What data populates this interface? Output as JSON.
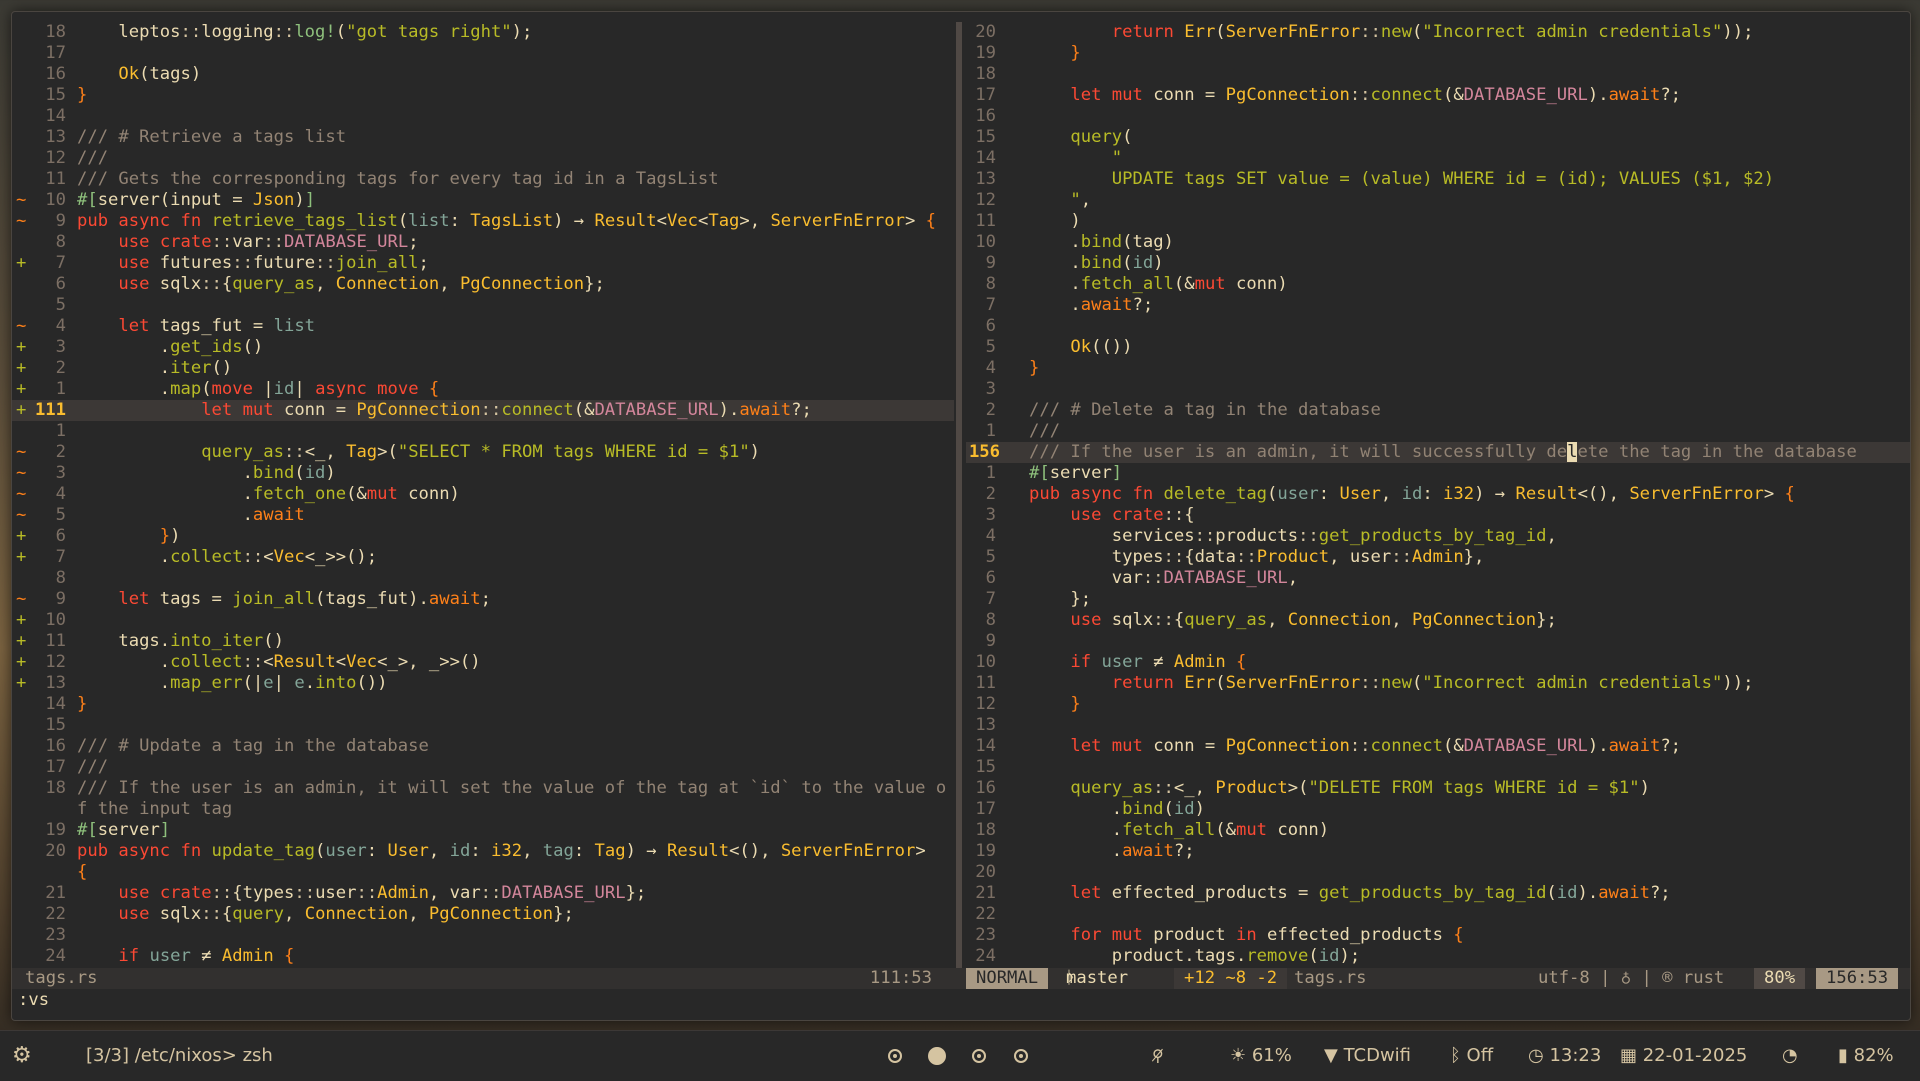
{
  "left_pane": {
    "filename": "tags.rs",
    "cursor_pos": "111:53"
  },
  "right_status": {
    "mode": "NORMAL",
    "branch": "master",
    "diff": "+12 ~8 -2",
    "filename": "tags.rs",
    "encoding": "utf-8 | ♁ | ® rust",
    "percent": "80%",
    "position": "156:53"
  },
  "command_line": ":vs",
  "panel": {
    "terminal_title": "[3/3] /etc/nixos> zsh",
    "brightness": "61%",
    "wifi": "TCDwifi",
    "bluetooth": "Off",
    "time": "13:23",
    "date": "22-01-2025",
    "battery": "82%"
  },
  "colors": {
    "background": "#282828",
    "foreground": "#ebdbb2",
    "keyword": "#fb4934",
    "type": "#fabd2f",
    "string": "#b8bb26",
    "comment": "#928374"
  }
}
